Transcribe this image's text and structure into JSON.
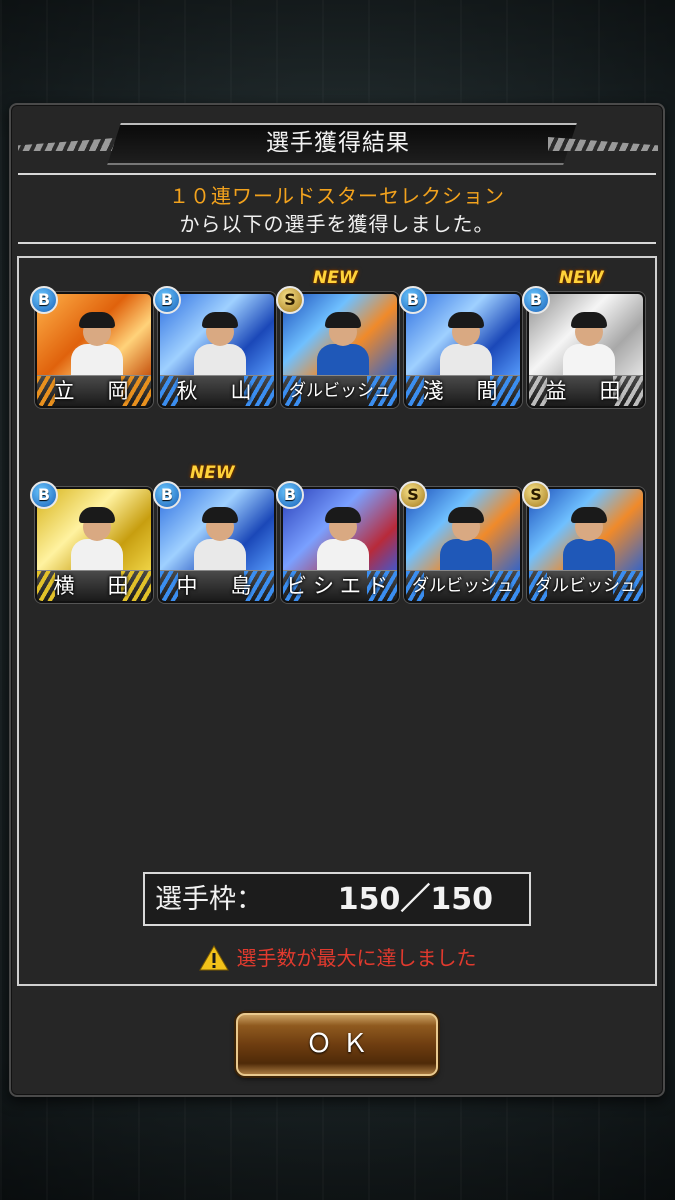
{
  "dialog": {
    "title": "選手獲得結果",
    "message_line1": "１０連ワールドスターセレクション",
    "message_line2": "から以下の選手を獲得しました。"
  },
  "cards": [
    {
      "name": "立　岡",
      "rank": "B",
      "is_new": false,
      "theme": "orange"
    },
    {
      "name": "秋　山",
      "rank": "B",
      "is_new": false,
      "theme": "blue"
    },
    {
      "name": "ダルビッシュ",
      "rank": "S",
      "is_new": true,
      "theme": "blue-fire"
    },
    {
      "name": "淺　間",
      "rank": "B",
      "is_new": false,
      "theme": "blue"
    },
    {
      "name": "益　田",
      "rank": "B",
      "is_new": true,
      "theme": "silver"
    },
    {
      "name": "横　田",
      "rank": "B",
      "is_new": false,
      "theme": "gold"
    },
    {
      "name": "中　島",
      "rank": "B",
      "is_new": true,
      "theme": "blue"
    },
    {
      "name": "ビシエド",
      "rank": "B",
      "is_new": false,
      "theme": "blue-red"
    },
    {
      "name": "ダルビッシュ",
      "rank": "S",
      "is_new": false,
      "theme": "blue-fire"
    },
    {
      "name": "ダルビッシュ",
      "rank": "S",
      "is_new": false,
      "theme": "blue-fire"
    }
  ],
  "new_label": "NEW",
  "capacity": {
    "label": "選手枠：",
    "value": "150／150"
  },
  "warning": {
    "icon": "warning-icon",
    "text": "選手数が最大に達しました"
  },
  "ok_button": {
    "label": "ＯＫ"
  }
}
